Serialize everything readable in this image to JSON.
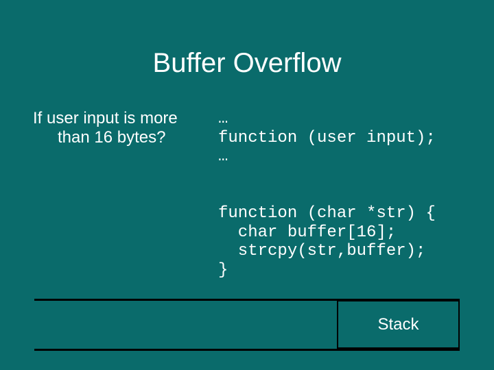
{
  "title": "Buffer Overflow",
  "left": {
    "line1": "If user input is more",
    "line2": "than 16 bytes?"
  },
  "code1": {
    "l1": "…",
    "l2": "function (user input);",
    "l3": "…"
  },
  "code2": {
    "l1": "function (char *str) {",
    "l2": "  char buffer[16];",
    "l3": "  strcpy(str,buffer);",
    "l4": "}"
  },
  "stack_label": "Stack"
}
